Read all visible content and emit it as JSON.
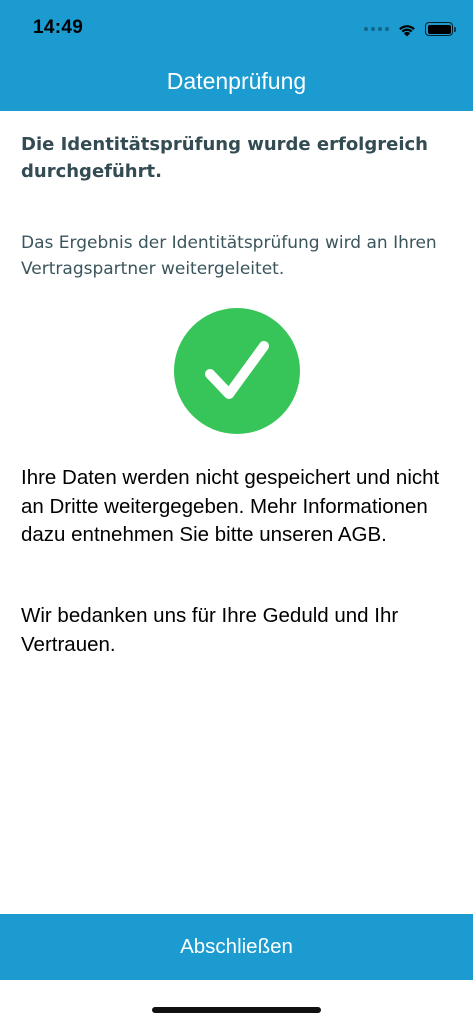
{
  "status_bar": {
    "time": "14:49",
    "icons": [
      "cellular-signal-icon",
      "wifi-icon",
      "battery-icon"
    ]
  },
  "nav": {
    "title": "Datenprüfung"
  },
  "content": {
    "heading": "Die Identitätsprüfung wurde erfolgreich durchgeführt.",
    "subtext": "Das Ergebnis der Identitätsprüfung wird an Ihren Vertragspartner weitergeleitet.",
    "status_icon": "checkmark-circle-icon",
    "body_privacy": "Ihre Daten werden nicht gespeichert und nicht an Dritte weitergegeben. Mehr Informationen dazu entnehmen Sie bitte unseren AGB.",
    "body_thanks": "Wir bedanken uns für Ihre Geduld und Ihr Vertrauen."
  },
  "footer": {
    "button_label": "Abschließen"
  },
  "colors": {
    "brand_blue": "#1c9bd1",
    "success_green": "#37c55a",
    "heading_text": "#334b52"
  }
}
